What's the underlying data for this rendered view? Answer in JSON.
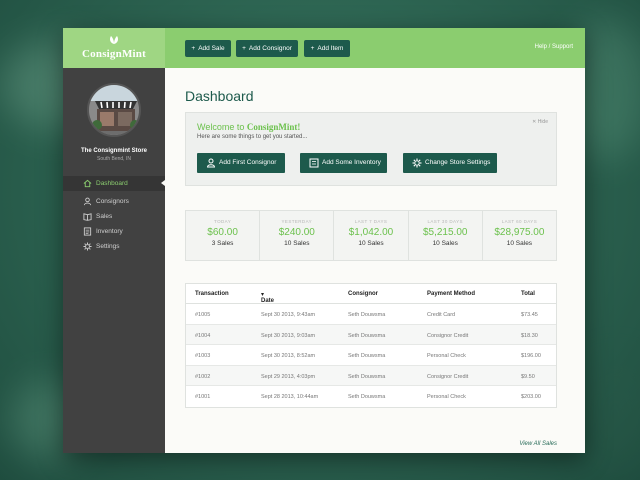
{
  "app": {
    "brand": "ConsignMint",
    "help_label": "Help / Support"
  },
  "toolbar": {
    "buttons": [
      {
        "label": "Add Sale",
        "icon": "plus-icon"
      },
      {
        "label": "Add Consignor",
        "icon": "plus-icon"
      },
      {
        "label": "Add Item",
        "icon": "plus-icon"
      }
    ]
  },
  "sidebar": {
    "store_name": "The Consignmint Store",
    "store_location": "South Bend, IN",
    "items": [
      {
        "label": "Dashboard",
        "icon": "home-icon",
        "active": true
      },
      {
        "label": "Consignors",
        "icon": "person-icon"
      },
      {
        "label": "Sales",
        "icon": "book-icon"
      },
      {
        "label": "Inventory",
        "icon": "list-icon"
      },
      {
        "label": "Settings",
        "icon": "gear-icon"
      }
    ]
  },
  "main": {
    "title": "Dashboard",
    "welcome": {
      "title_prefix": "Welcome to ",
      "title_brand": "ConsignMint!",
      "subtitle": "Here are some things to get you started...",
      "hide_label": "Hide",
      "actions": [
        {
          "label": "Add First Consignor",
          "icon": "person-icon"
        },
        {
          "label": "Add Some Inventory",
          "icon": "inventory-icon"
        },
        {
          "label": "Change Store Settings",
          "icon": "gear-icon"
        }
      ]
    },
    "stats": [
      {
        "label": "TODAY",
        "amount": "$60.00",
        "sales": "3 Sales"
      },
      {
        "label": "YESTERDAY",
        "amount": "$240.00",
        "sales": "10 Sales"
      },
      {
        "label": "LAST 7 DAYS",
        "amount": "$1,042.00",
        "sales": "10 Sales"
      },
      {
        "label": "LAST 30 DAYS",
        "amount": "$5,215.00",
        "sales": "10 Sales"
      },
      {
        "label": "LAST 60 DAYS",
        "amount": "$28,975.00",
        "sales": "10 Sales"
      }
    ],
    "table": {
      "columns": [
        "Transaction",
        "Date",
        "Consignor",
        "Payment Method",
        "Total"
      ],
      "sort_indicator": "▾",
      "rows": [
        [
          "#1005",
          "Sept 30 2013, 9:43am",
          "Seth Douwsma",
          "Credit Card",
          "$73.45"
        ],
        [
          "#1004",
          "Sept 30 2013, 9:03am",
          "Seth Douwsma",
          "Consignor Credit",
          "$18.30"
        ],
        [
          "#1003",
          "Sept 30 2013, 8:52am",
          "Seth Douwsma",
          "Personal Check",
          "$196.00"
        ],
        [
          "#1002",
          "Sept 29 2013, 4:03pm",
          "Seth Douwsma",
          "Consignor Credit",
          "$9.50"
        ],
        [
          "#1001",
          "Sept 28 2013, 10:44am",
          "Seth Douwsma",
          "Personal Check",
          "$203.00"
        ]
      ],
      "view_all_label": "View All Sales"
    }
  },
  "colors": {
    "topbar": "#8bcd6f",
    "accent_dark": "#1d5a4c",
    "accent_green": "#6cc14d",
    "sidebar": "#414141"
  }
}
